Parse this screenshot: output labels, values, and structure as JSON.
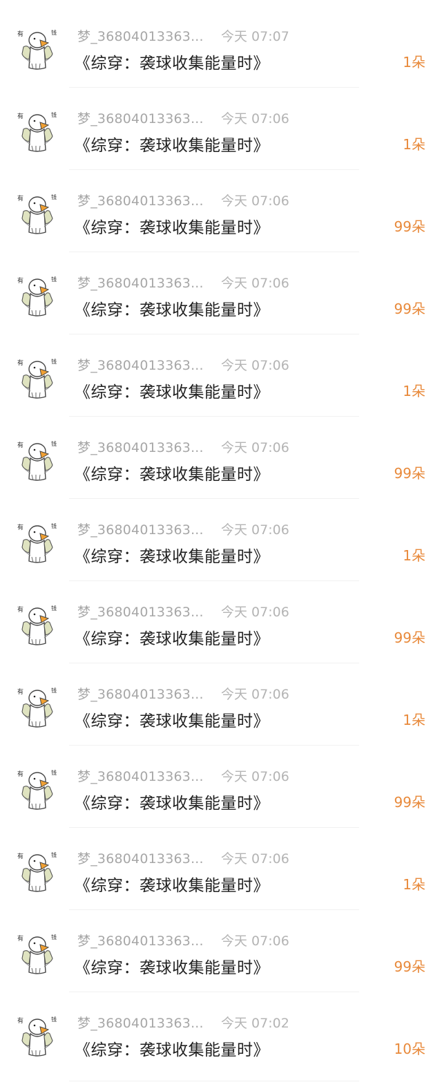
{
  "colors": {
    "name_text": "#a7a7a7",
    "time_text": "#b4b4b4",
    "title_text": "#222222",
    "count_text": "#e8893a",
    "divider": "#f1f1f1"
  },
  "avatar": {
    "icon": "goose-meme-avatar-icon",
    "caption_left": "有",
    "caption_right": "钱"
  },
  "items": [
    {
      "user": "梦_36804013363...",
      "time": "今天 07:07",
      "book": "《综穿：袭球收集能量时》",
      "count": "1朵"
    },
    {
      "user": "梦_36804013363...",
      "time": "今天 07:06",
      "book": "《综穿：袭球收集能量时》",
      "count": "1朵"
    },
    {
      "user": "梦_36804013363...",
      "time": "今天 07:06",
      "book": "《综穿：袭球收集能量时》",
      "count": "99朵"
    },
    {
      "user": "梦_36804013363...",
      "time": "今天 07:06",
      "book": "《综穿：袭球收集能量时》",
      "count": "99朵"
    },
    {
      "user": "梦_36804013363...",
      "time": "今天 07:06",
      "book": "《综穿：袭球收集能量时》",
      "count": "1朵"
    },
    {
      "user": "梦_36804013363...",
      "time": "今天 07:06",
      "book": "《综穿：袭球收集能量时》",
      "count": "99朵"
    },
    {
      "user": "梦_36804013363...",
      "time": "今天 07:06",
      "book": "《综穿：袭球收集能量时》",
      "count": "1朵"
    },
    {
      "user": "梦_36804013363...",
      "time": "今天 07:06",
      "book": "《综穿：袭球收集能量时》",
      "count": "99朵"
    },
    {
      "user": "梦_36804013363...",
      "time": "今天 07:06",
      "book": "《综穿：袭球收集能量时》",
      "count": "1朵"
    },
    {
      "user": "梦_36804013363...",
      "time": "今天 07:06",
      "book": "《综穿：袭球收集能量时》",
      "count": "99朵"
    },
    {
      "user": "梦_36804013363...",
      "time": "今天 07:06",
      "book": "《综穿：袭球收集能量时》",
      "count": "1朵"
    },
    {
      "user": "梦_36804013363...",
      "time": "今天 07:06",
      "book": "《综穿：袭球收集能量时》",
      "count": "99朵"
    },
    {
      "user": "梦_36804013363...",
      "time": "今天 07:02",
      "book": "《综穿：袭球收集能量时》",
      "count": "10朵"
    }
  ]
}
